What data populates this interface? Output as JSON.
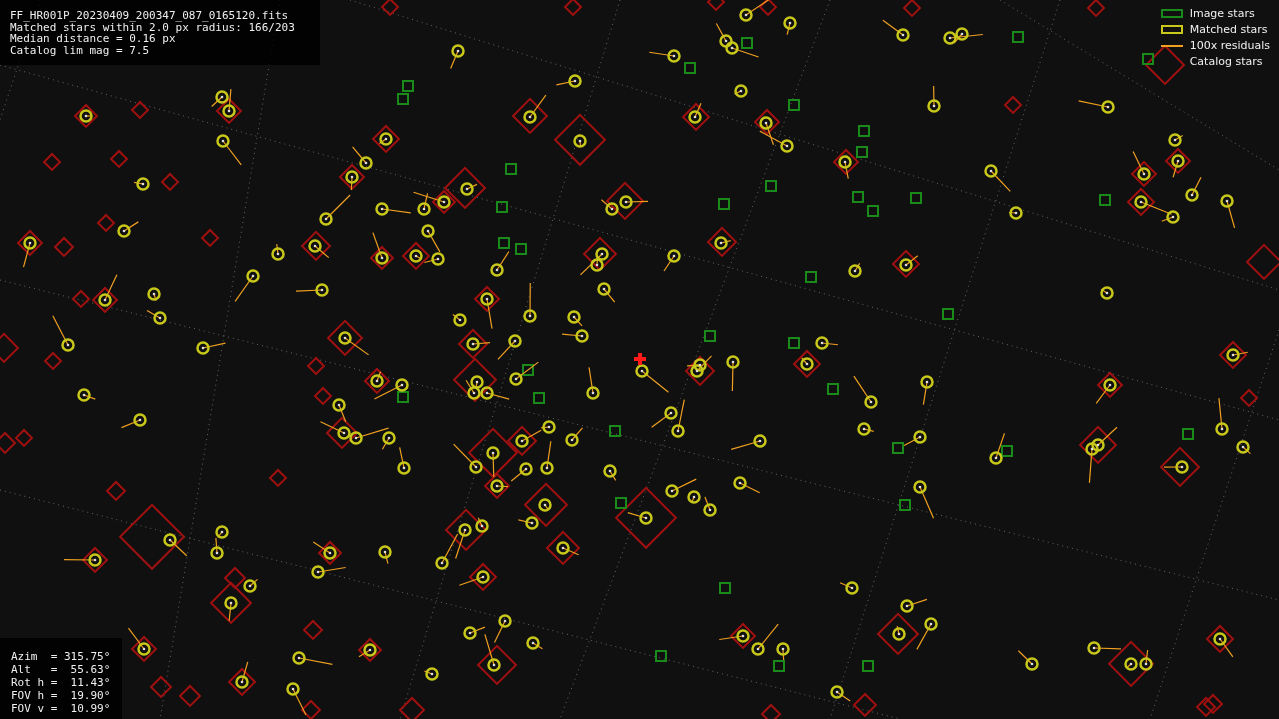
{
  "file_info": {
    "lines": [
      "FF_HR001P_20230409_200347_087_0165120.fits",
      "Matched stars within 2.0 px radius: 166/203",
      "Median distance = 0.16 px",
      "Catalog lim mag = 7.5"
    ]
  },
  "legend": [
    {
      "kind": "green-box",
      "label": "Image stars"
    },
    {
      "kind": "yellow-box",
      "label": "Matched stars"
    },
    {
      "kind": "orange-line",
      "label": "100x residuals"
    },
    {
      "kind": "none",
      "label": "Catalog stars"
    }
  ],
  "pointing": {
    "lines": [
      "Azim  = 315.75°",
      "Alt   =  55.63°",
      "Rot h =  11.43°",
      "FOV h =  19.90°",
      "FOV v =  10.99°"
    ]
  }
}
